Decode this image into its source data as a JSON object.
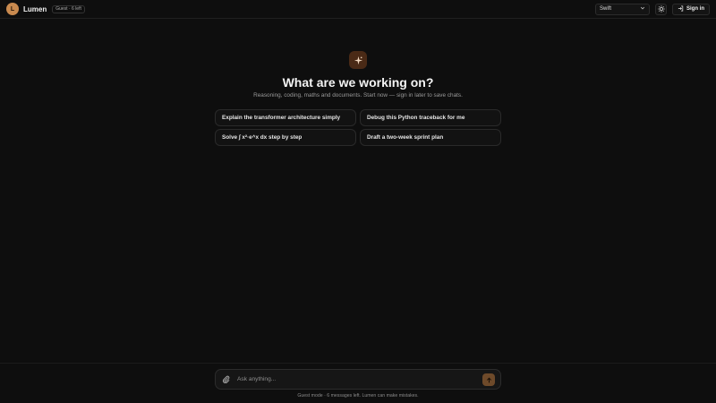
{
  "header": {
    "logo_letter": "L",
    "brand": "Lumen",
    "guest_pill": "Guest · 6 left",
    "model_selected": "Swift",
    "signin_label": "Sign in",
    "icons": [
      "sun-icon",
      "chevron-down-icon",
      "sign-in-icon"
    ]
  },
  "hero": {
    "icon": "sparkle-icon",
    "title": "What are we working on?",
    "subtitle": "Reasoning, coding, maths and documents. Start now — sign in later to save chats."
  },
  "suggestions": [
    {
      "label": "Explain the transformer architecture simply"
    },
    {
      "label": "Debug this Python traceback for me"
    },
    {
      "label": "Solve ∫ x²·e^x dx step by step"
    },
    {
      "label": "Draft a two-week sprint plan"
    }
  ],
  "composer": {
    "placeholder": "Ask anything...",
    "footnote": "Guest mode · 6 messages left. Lumen can make mistakes."
  },
  "colors": {
    "background": "#0e0e0e",
    "accent": "#c98a4f",
    "send_button": "#6e4a2a"
  }
}
